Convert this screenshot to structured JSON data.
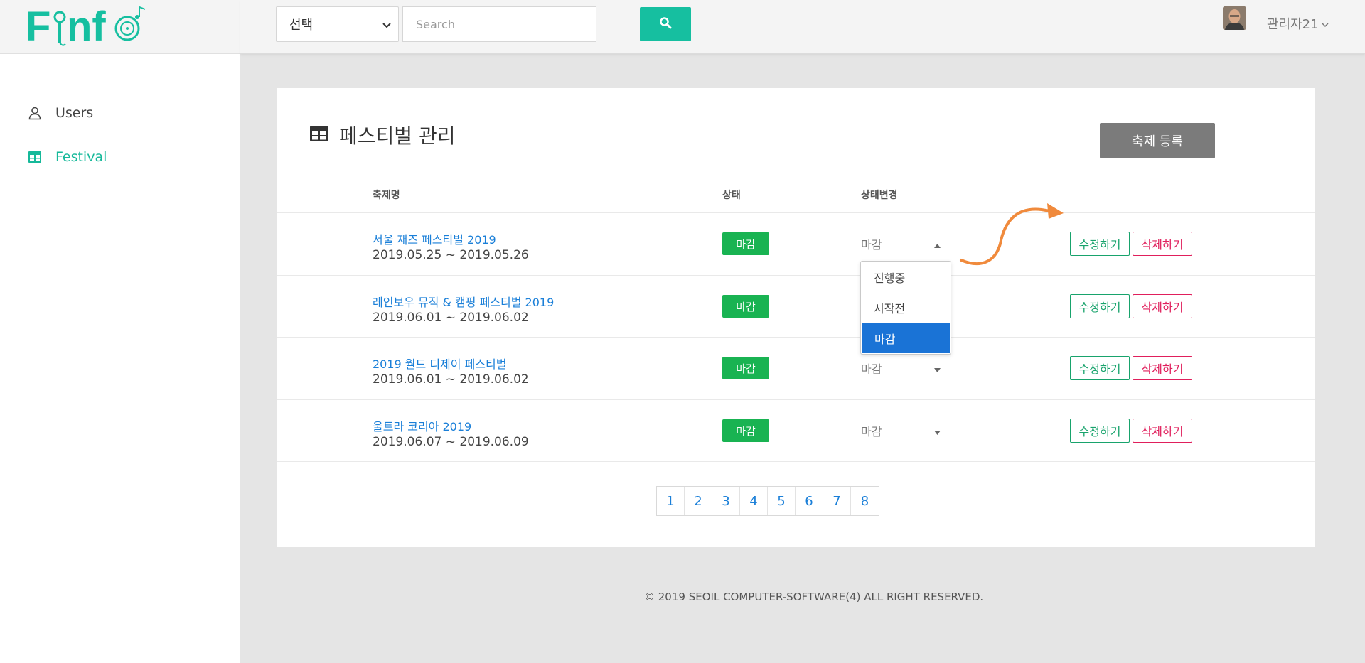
{
  "brand": {
    "logo_text": "Finfo",
    "colors": {
      "accent": "#16bfa0",
      "link": "#1a7fd8",
      "status_closed": "#19b352",
      "edit": "#18a36c",
      "delete": "#e01f5c",
      "add_button": "#7b7b7b"
    }
  },
  "sidebar": {
    "items": [
      {
        "label": "Users",
        "icon": "user-icon",
        "active": false
      },
      {
        "label": "Festival",
        "icon": "table-icon",
        "active": true
      }
    ]
  },
  "topbar": {
    "select_value": "선택",
    "search_placeholder": "Search",
    "search_icon": "search-icon",
    "user_name": "관리자21"
  },
  "main": {
    "title": "페스티벌 관리",
    "add_button": "축제 등록",
    "columns": [
      "축제명",
      "상태",
      "상태변경"
    ],
    "rows": [
      {
        "name": "서울 재즈 페스티벌 2019",
        "dates": "2019.05.25 ~ 2019.05.26",
        "status": "마감",
        "change": "마감",
        "edit": "수정하기",
        "delete": "삭제하기"
      },
      {
        "name": "레인보우 뮤직 & 캠핑 페스티벌 2019",
        "dates": "2019.06.01 ~ 2019.06.02",
        "status": "마감",
        "change": "마감",
        "edit": "수정하기",
        "delete": "삭제하기"
      },
      {
        "name": "2019 월드 디제이 페스티벌",
        "dates": "2019.06.01 ~ 2019.06.02",
        "status": "마감",
        "change": "마감",
        "edit": "수정하기",
        "delete": "삭제하기"
      },
      {
        "name": "울트라 코리아 2019",
        "dates": "2019.06.07 ~ 2019.06.09",
        "status": "마감",
        "change": "마감",
        "edit": "수정하기",
        "delete": "삭제하기"
      }
    ],
    "dropdown_options": [
      "진행중",
      "시작전",
      "마감"
    ],
    "dropdown_selected": "마감",
    "pages": [
      "1",
      "2",
      "3",
      "4",
      "5",
      "6",
      "7",
      "8"
    ]
  },
  "footer": {
    "text": "© 2019 SEOIL COMPUTER-SOFTWARE(4) ALL RIGHT RESERVED."
  }
}
